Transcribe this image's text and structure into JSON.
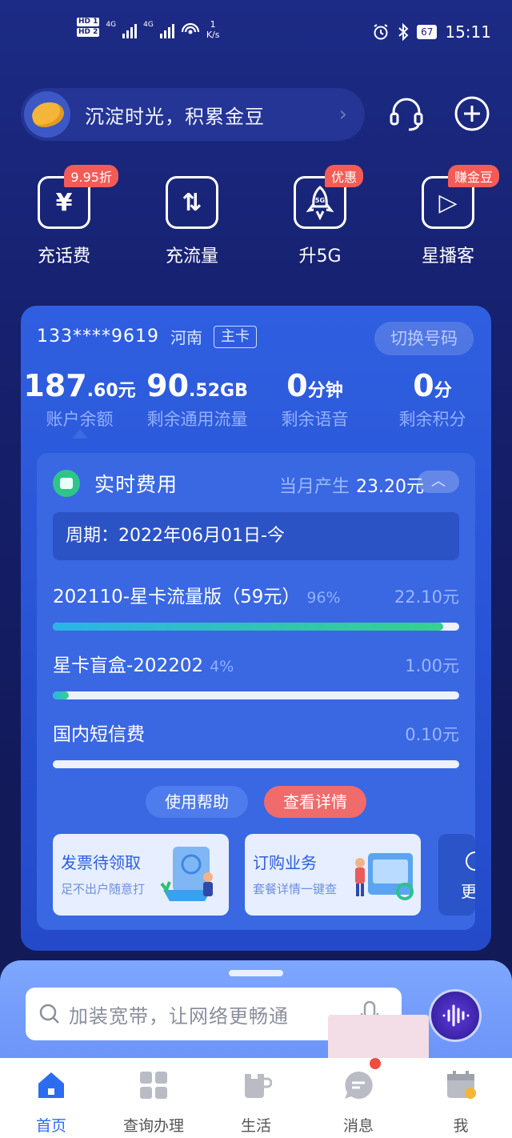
{
  "status_bar": {
    "hd1": "HD 1",
    "hd2": "HD 2",
    "net1": "4G",
    "net2": "4G",
    "speed_value": "1",
    "speed_unit": "K/s",
    "battery": "67",
    "time": "15:11"
  },
  "top": {
    "bean_text": "沉淀时光，积累金豆"
  },
  "actions": [
    {
      "label": "充话费",
      "glyph": "¥",
      "badge": "9.95折"
    },
    {
      "label": "充流量",
      "glyph": "⇅",
      "badge": ""
    },
    {
      "label": "升5G",
      "glyph": "5G",
      "badge": "优惠"
    },
    {
      "label": "星播客",
      "glyph": "▷",
      "badge": "赚金豆"
    }
  ],
  "account": {
    "phone": "133****9619",
    "province": "河南",
    "card_type": "主卡",
    "switch_label": "切换号码",
    "stats": [
      {
        "value": "187",
        "decimal": ".60",
        "unit": "元",
        "label": "账户余额"
      },
      {
        "value": "90",
        "decimal": ".52",
        "unit": "GB",
        "label": "剩余通用流量"
      },
      {
        "value": "0",
        "decimal": "",
        "unit": "分钟",
        "label": "剩余语音"
      },
      {
        "value": "0",
        "decimal": "",
        "unit": "分",
        "label": "剩余积分"
      }
    ]
  },
  "fees": {
    "title": "实时费用",
    "month_label": "当月产生",
    "month_value": "23.20元",
    "period": "周期：2022年06月01日-今",
    "items": [
      {
        "name": "202110-星卡流量版（59元）",
        "pct": "96%",
        "amount": "22.10元",
        "fill": 0.96
      },
      {
        "name": "星卡盲盒-202202",
        "pct": "4%",
        "amount": "1.00元",
        "fill": 0.04
      },
      {
        "name": "国内短信费",
        "pct": "",
        "amount": "0.10元",
        "fill": 0.0
      }
    ],
    "help_label": "使用帮助",
    "detail_label": "查看详情"
  },
  "promos": [
    {
      "title": "发票待领取",
      "subtitle": "足不出户随意打"
    },
    {
      "title": "订购业务",
      "subtitle": "套餐详情一键查"
    },
    {
      "title": "更",
      "subtitle": ""
    }
  ],
  "search": {
    "placeholder": "加装宽带，让网络更畅通"
  },
  "nav": [
    {
      "label": "首页"
    },
    {
      "label": "查询办理"
    },
    {
      "label": "生活"
    },
    {
      "label": "消息"
    },
    {
      "label": "我"
    }
  ],
  "colors": {
    "accent": "#2c6cf0",
    "badge": "#f35b57",
    "detail_button": "#f06b6b"
  }
}
